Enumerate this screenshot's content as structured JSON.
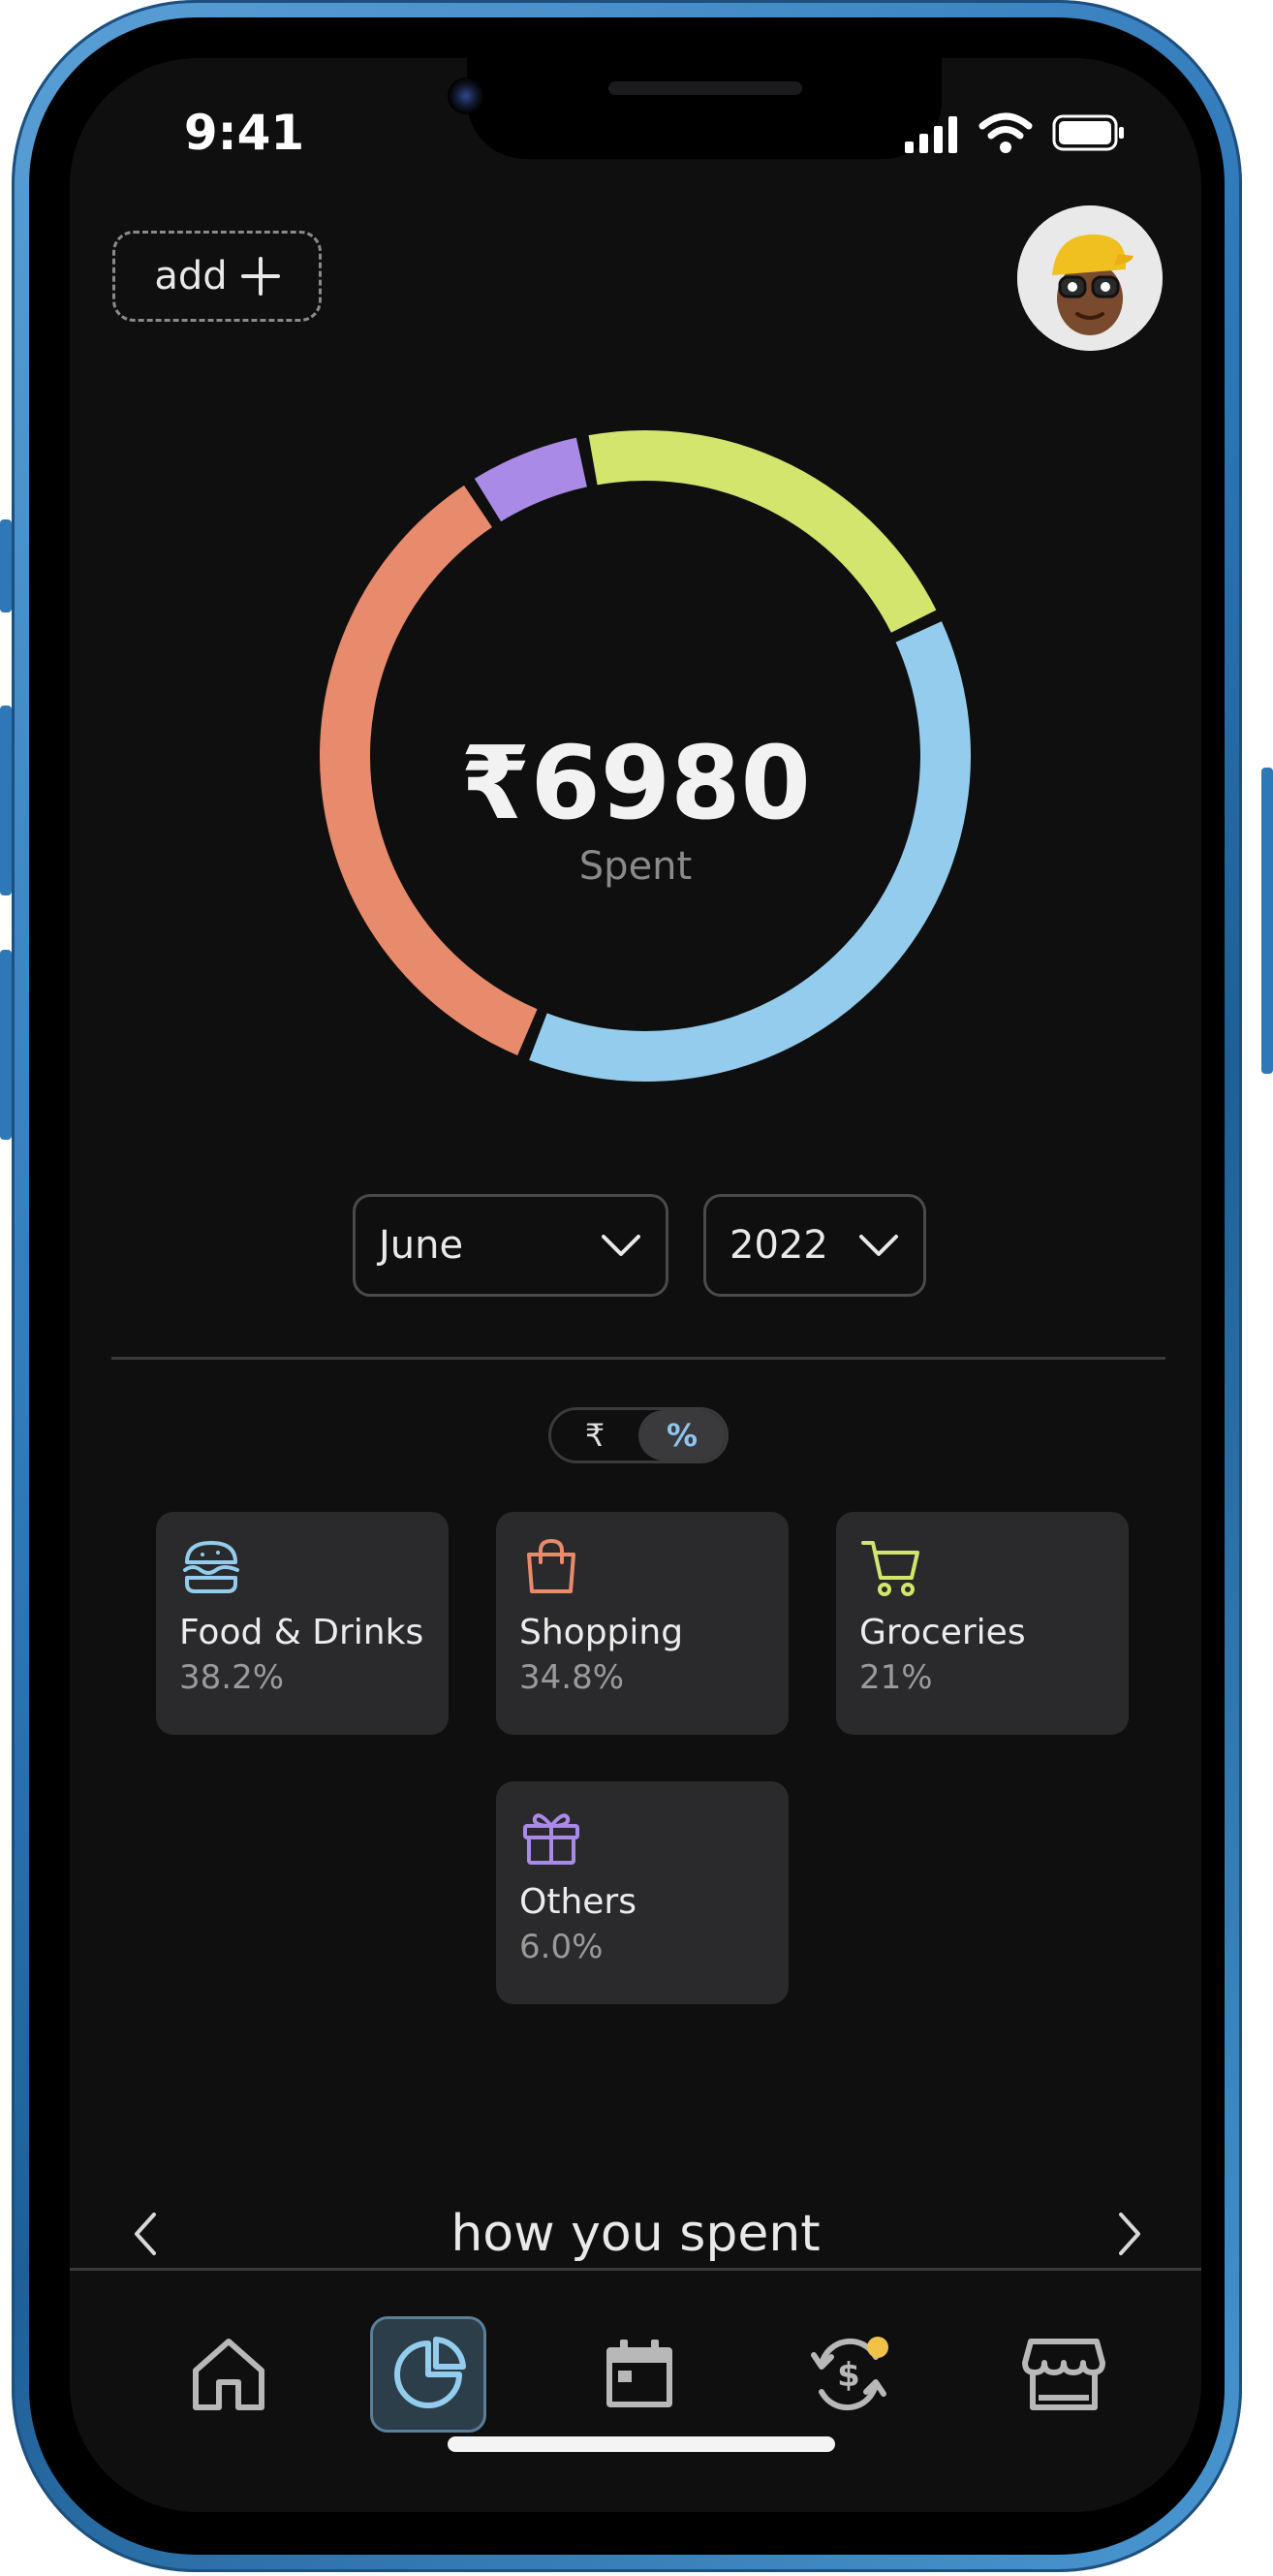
{
  "status_bar": {
    "time": "9:41"
  },
  "header": {
    "add_label": "add"
  },
  "summary": {
    "currency_symbol": "₹",
    "amount": "₹6980",
    "subtitle": "Spent"
  },
  "donut": {
    "segments": [
      {
        "category": "Food & Drinks",
        "percent": 38.2,
        "color": "#93CCEC"
      },
      {
        "category": "Shopping",
        "percent": 34.8,
        "color": "#E88B6C"
      },
      {
        "category": "Groceries",
        "percent": 21,
        "color": "#D4E56D"
      },
      {
        "category": "Others",
        "percent": 6.0,
        "color": "#A98AE6"
      }
    ]
  },
  "filters": {
    "month": "June",
    "year": "2022"
  },
  "toggle": {
    "options": [
      "₹",
      "%"
    ],
    "selected": "%"
  },
  "categories": [
    {
      "name": "Food & Drinks",
      "value": "38.2%",
      "icon": "burger-icon",
      "color": "#93CCEC"
    },
    {
      "name": "Shopping",
      "value": "34.8%",
      "icon": "shopping-bag-icon",
      "color": "#E88B6C"
    },
    {
      "name": "Groceries",
      "value": "21%",
      "icon": "cart-icon",
      "color": "#D4E56D"
    },
    {
      "name": "Others",
      "value": "6.0%",
      "icon": "gift-icon",
      "color": "#A98AE6"
    }
  ],
  "section": {
    "title": "how you spent"
  },
  "tab_bar": {
    "tabs": [
      {
        "name": "home",
        "icon": "home-icon"
      },
      {
        "name": "analytics",
        "icon": "pie-chart-icon",
        "active": true
      },
      {
        "name": "calendar",
        "icon": "calendar-icon"
      },
      {
        "name": "exchange",
        "icon": "currency-exchange-icon",
        "badge": true
      },
      {
        "name": "store",
        "icon": "store-icon"
      }
    ]
  }
}
